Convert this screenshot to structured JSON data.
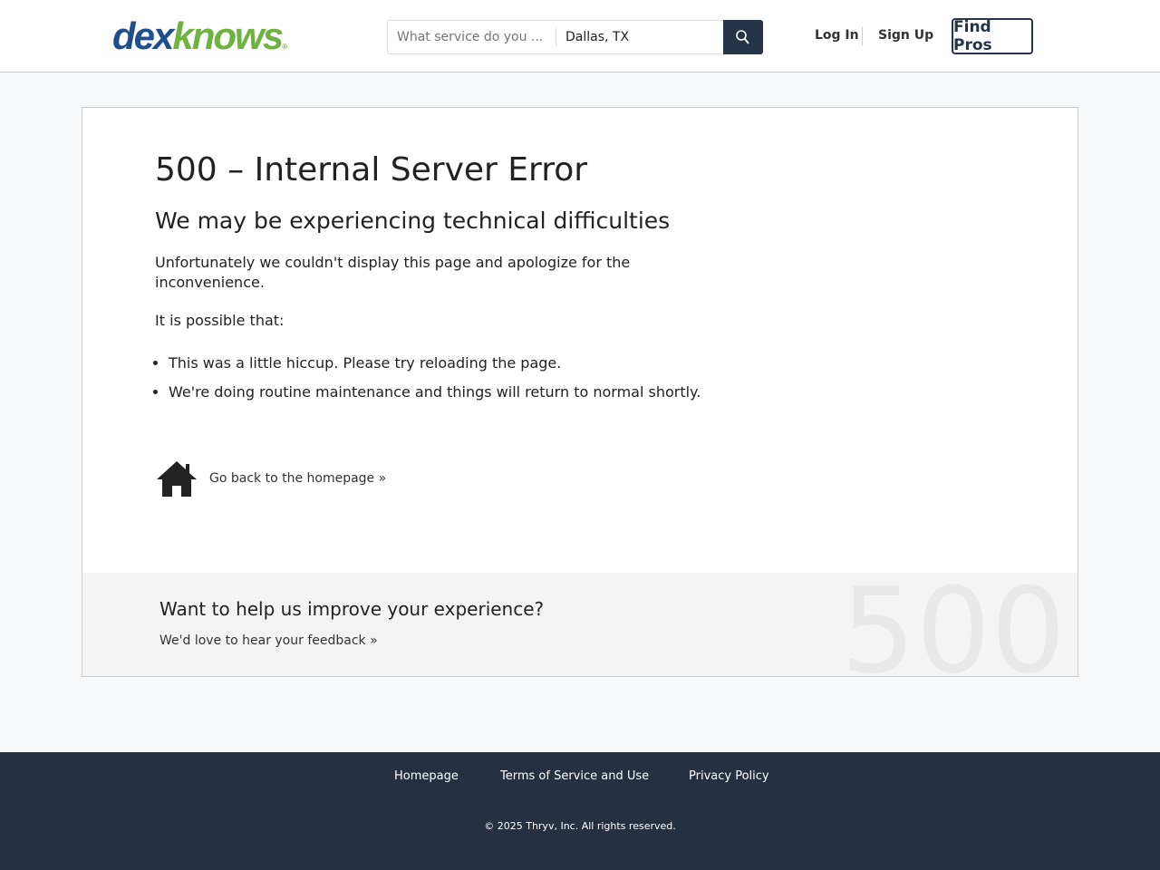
{
  "header": {
    "logo": {
      "part1": "dex",
      "part2": "knows",
      "reg": "®"
    },
    "search_placeholder": "What service do you ...",
    "location_value": "Dallas, TX",
    "login": "Log In",
    "signup": "Sign Up",
    "find_pros": "Find Pros"
  },
  "main": {
    "title": "500 – Internal Server Error",
    "subtitle": "We may be experiencing technical difficulties",
    "intro": "Unfortunately we couldn't display this page and apologize for the inconvenience.",
    "possible": "It is possible that:",
    "reasons": [
      "This was a little hiccup. Please try reloading the page.",
      "We're doing routine maintenance and things will return to normal shortly."
    ],
    "home_link": "Go back to the homepage »"
  },
  "feedback": {
    "title": "Want to help us improve your experience?",
    "link": "We'd love to hear your feedback »",
    "watermark": "500"
  },
  "footer": {
    "links": [
      "Homepage",
      "Terms of Service and Use",
      "Privacy Policy"
    ],
    "copyright": "© 2025 Thryv, Inc. All rights reserved."
  }
}
